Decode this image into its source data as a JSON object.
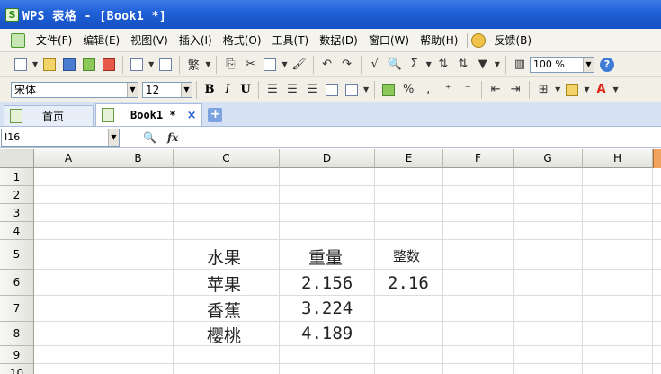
{
  "window": {
    "app_icon": "S",
    "title": "WPS 表格 - [Book1 *]"
  },
  "menu": {
    "items": [
      "文件(F)",
      "编辑(E)",
      "视图(V)",
      "插入(I)",
      "格式(O)",
      "工具(T)",
      "数据(D)",
      "窗口(W)",
      "帮助(H)"
    ],
    "feedback": "反馈(B)"
  },
  "toolbar": {
    "traditional_char": "繁",
    "sum_symbol": "Σ",
    "zoom": "100 %",
    "help": "?"
  },
  "format_toolbar": {
    "font_name": "宋体",
    "font_size": "12",
    "bold": "B",
    "italic": "I",
    "underline": "U",
    "percent": "%",
    "comma": ",",
    "font_color_letter": "A"
  },
  "tabs": {
    "home": "首页",
    "book": "Book1 *",
    "close": "×",
    "add": "+"
  },
  "formula_bar": {
    "cell_ref": "I16",
    "fx": "fx"
  },
  "sheet": {
    "columns": [
      "A",
      "B",
      "C",
      "D",
      "E",
      "F",
      "G",
      "H"
    ],
    "rows": [
      "1",
      "2",
      "3",
      "4",
      "5",
      "6",
      "7",
      "8",
      "9",
      "10"
    ],
    "cells": {
      "C5": "水果",
      "D5": "重量",
      "E5": "整数",
      "C6": "苹果",
      "D6": "2.156",
      "E6": "2.16",
      "C7": "香蕉",
      "D7": "3.224",
      "C8": "樱桃",
      "D8": "4.189"
    }
  }
}
